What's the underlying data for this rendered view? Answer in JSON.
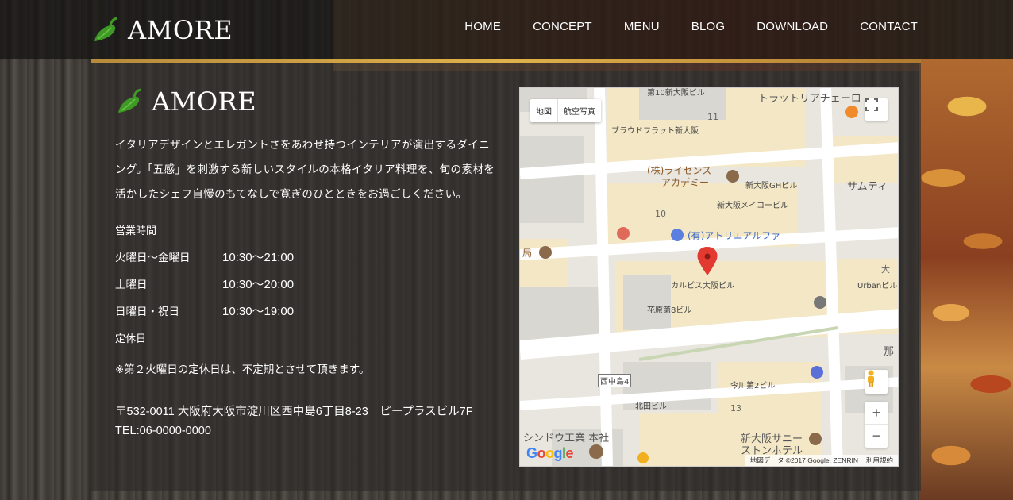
{
  "brand": {
    "name": "AMORE",
    "logo_icon": "pepper-icon"
  },
  "nav": {
    "items": [
      {
        "label": "HOME"
      },
      {
        "label": "CONCEPT"
      },
      {
        "label": "MENU"
      },
      {
        "label": "BLOG"
      },
      {
        "label": "DOWNLOAD"
      },
      {
        "label": "CONTACT"
      }
    ]
  },
  "intro": {
    "text": "イタリアデザインとエレガントさをあわせ持つインテリアが演出するダイニング。「五感」を刺激する新しいスタイルの本格イタリア料理を、旬の素材を活かしたシェフ自慢のもてなしで寛ぎのひとときをお過ごしください。"
  },
  "hours": {
    "title": "営業時間",
    "rows": [
      {
        "day": "火曜日〜金曜日",
        "time": "10:30〜21:00"
      },
      {
        "day": "土曜日",
        "time": "10:30〜20:00"
      },
      {
        "day": "日曜日・祝日",
        "time": "10:30〜19:00"
      }
    ]
  },
  "closed": {
    "title": "定休日",
    "note": "※第２火曜日の定休日は、不定期とさせて頂きます。"
  },
  "contact": {
    "address": "〒532-0011 大阪府大阪市淀川区西中島6丁目8-23　ピープラスビル7F",
    "tel": "TEL:06-0000-0000"
  },
  "map": {
    "type_buttons": {
      "map": "地図",
      "satellite": "航空写真"
    },
    "zoom_in": "+",
    "zoom_out": "−",
    "google": [
      "G",
      "o",
      "o",
      "g",
      "l",
      "e"
    ],
    "google_colors": [
      "#4285f4",
      "#ea4335",
      "#fbbc05",
      "#4285f4",
      "#34a853",
      "#ea4335"
    ],
    "attribution": "地図データ ©2017 Google, ZENRIN",
    "terms": "利用規約",
    "labels": {
      "trattoria": "トラットリアチェーロ",
      "braudfrat": "ブラウドフラット新大阪",
      "license": "(株)ライセンス",
      "academy": "アカデミー",
      "gh": "新大阪GHビル",
      "mei": "新大阪メイコービル",
      "samu": "サムティ",
      "atelier": "(有)アトリエアルファ",
      "calpis": "カルピス大阪ビル",
      "hanahara": "花原第8ビル",
      "kyoku": "局",
      "nishinakajima": "西中島4",
      "imagawa": "今川第2ビル",
      "kitada": "北田ビル",
      "shindo": "シンドウ工業 本社",
      "sunny1": "新大阪サニー",
      "sunny2": "ストンホテル",
      "urban": "Urbanビル",
      "na": "那",
      "dai": "大",
      "n11": "11",
      "n10": "10",
      "n13": "13",
      "top": "第10新大阪ビル"
    }
  }
}
